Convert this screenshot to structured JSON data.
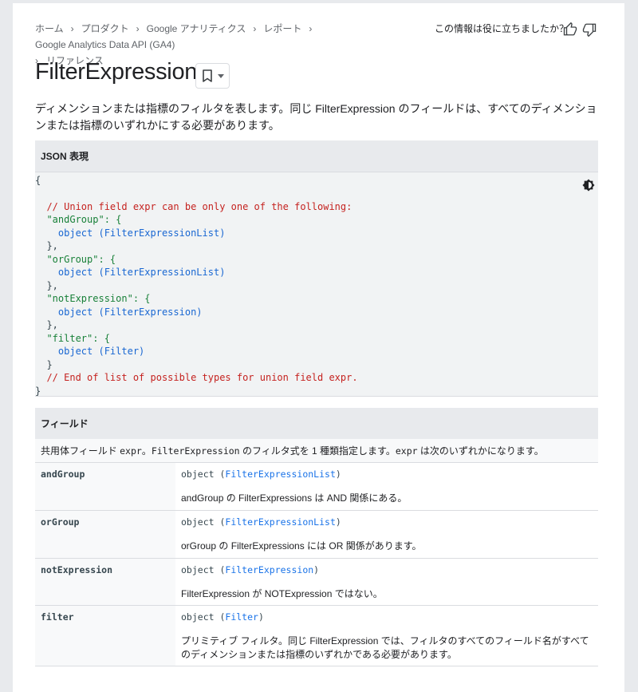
{
  "breadcrumb": {
    "items": [
      "ホーム",
      "プロダクト",
      "Google アナリティクス",
      "レポート",
      "Google Analytics Data API (GA4)",
      "リファレンス"
    ]
  },
  "feedback": {
    "question": "この情報は役に立ちましたか？"
  },
  "page": {
    "title": "FilterExpression",
    "description": "ディメンションまたは指標のフィルタを表します。同じ FilterExpression のフィールドは、すべてのディメンションまたは指標のいずれかにする必要があります。"
  },
  "json_section": {
    "heading": "JSON 表現",
    "lines": [
      "{",
      "",
      "  // Union field expr can be only one of the following:",
      "  \"andGroup\": {",
      "    object (FilterExpressionList)",
      "  },",
      "  \"orGroup\": {",
      "    object (FilterExpressionList)",
      "  },",
      "  \"notExpression\": {",
      "    object (FilterExpression)",
      "  },",
      "  \"filter\": {",
      "    object (Filter)",
      "  }",
      "  // End of list of possible types for union field expr.",
      "}"
    ]
  },
  "fields_section": {
    "heading": "フィールド",
    "intro_prefix": "共用体フィールド ",
    "intro_code1": "expr",
    "intro_mid": "。",
    "intro_code2": "FilterExpression",
    "intro_mid2": " のフィルタ式を 1 種類指定します。",
    "intro_code3": "expr",
    "intro_suffix": " は次のいずれかになります。",
    "fields": [
      {
        "name": "andGroup",
        "type_prefix": "object (",
        "type_link": "FilterExpressionList",
        "type_suffix": ")",
        "description": "andGroup の FilterExpressions は AND 関係にある。"
      },
      {
        "name": "orGroup",
        "type_prefix": "object (",
        "type_link": "FilterExpressionList",
        "type_suffix": ")",
        "description": "orGroup の FilterExpressions には OR 関係があります。"
      },
      {
        "name": "notExpression",
        "type_prefix": "object (",
        "type_link": "FilterExpression",
        "type_suffix": ")",
        "description": "FilterExpression が NOTExpression ではない。"
      },
      {
        "name": "filter",
        "type_prefix": "object (",
        "type_link": "Filter",
        "type_suffix": ")",
        "description": "プリミティブ フィルタ。同じ FilterExpression では、フィルタのすべてのフィールド名がすべてのディメンションまたは指標のいずれかである必要があります。"
      }
    ]
  }
}
